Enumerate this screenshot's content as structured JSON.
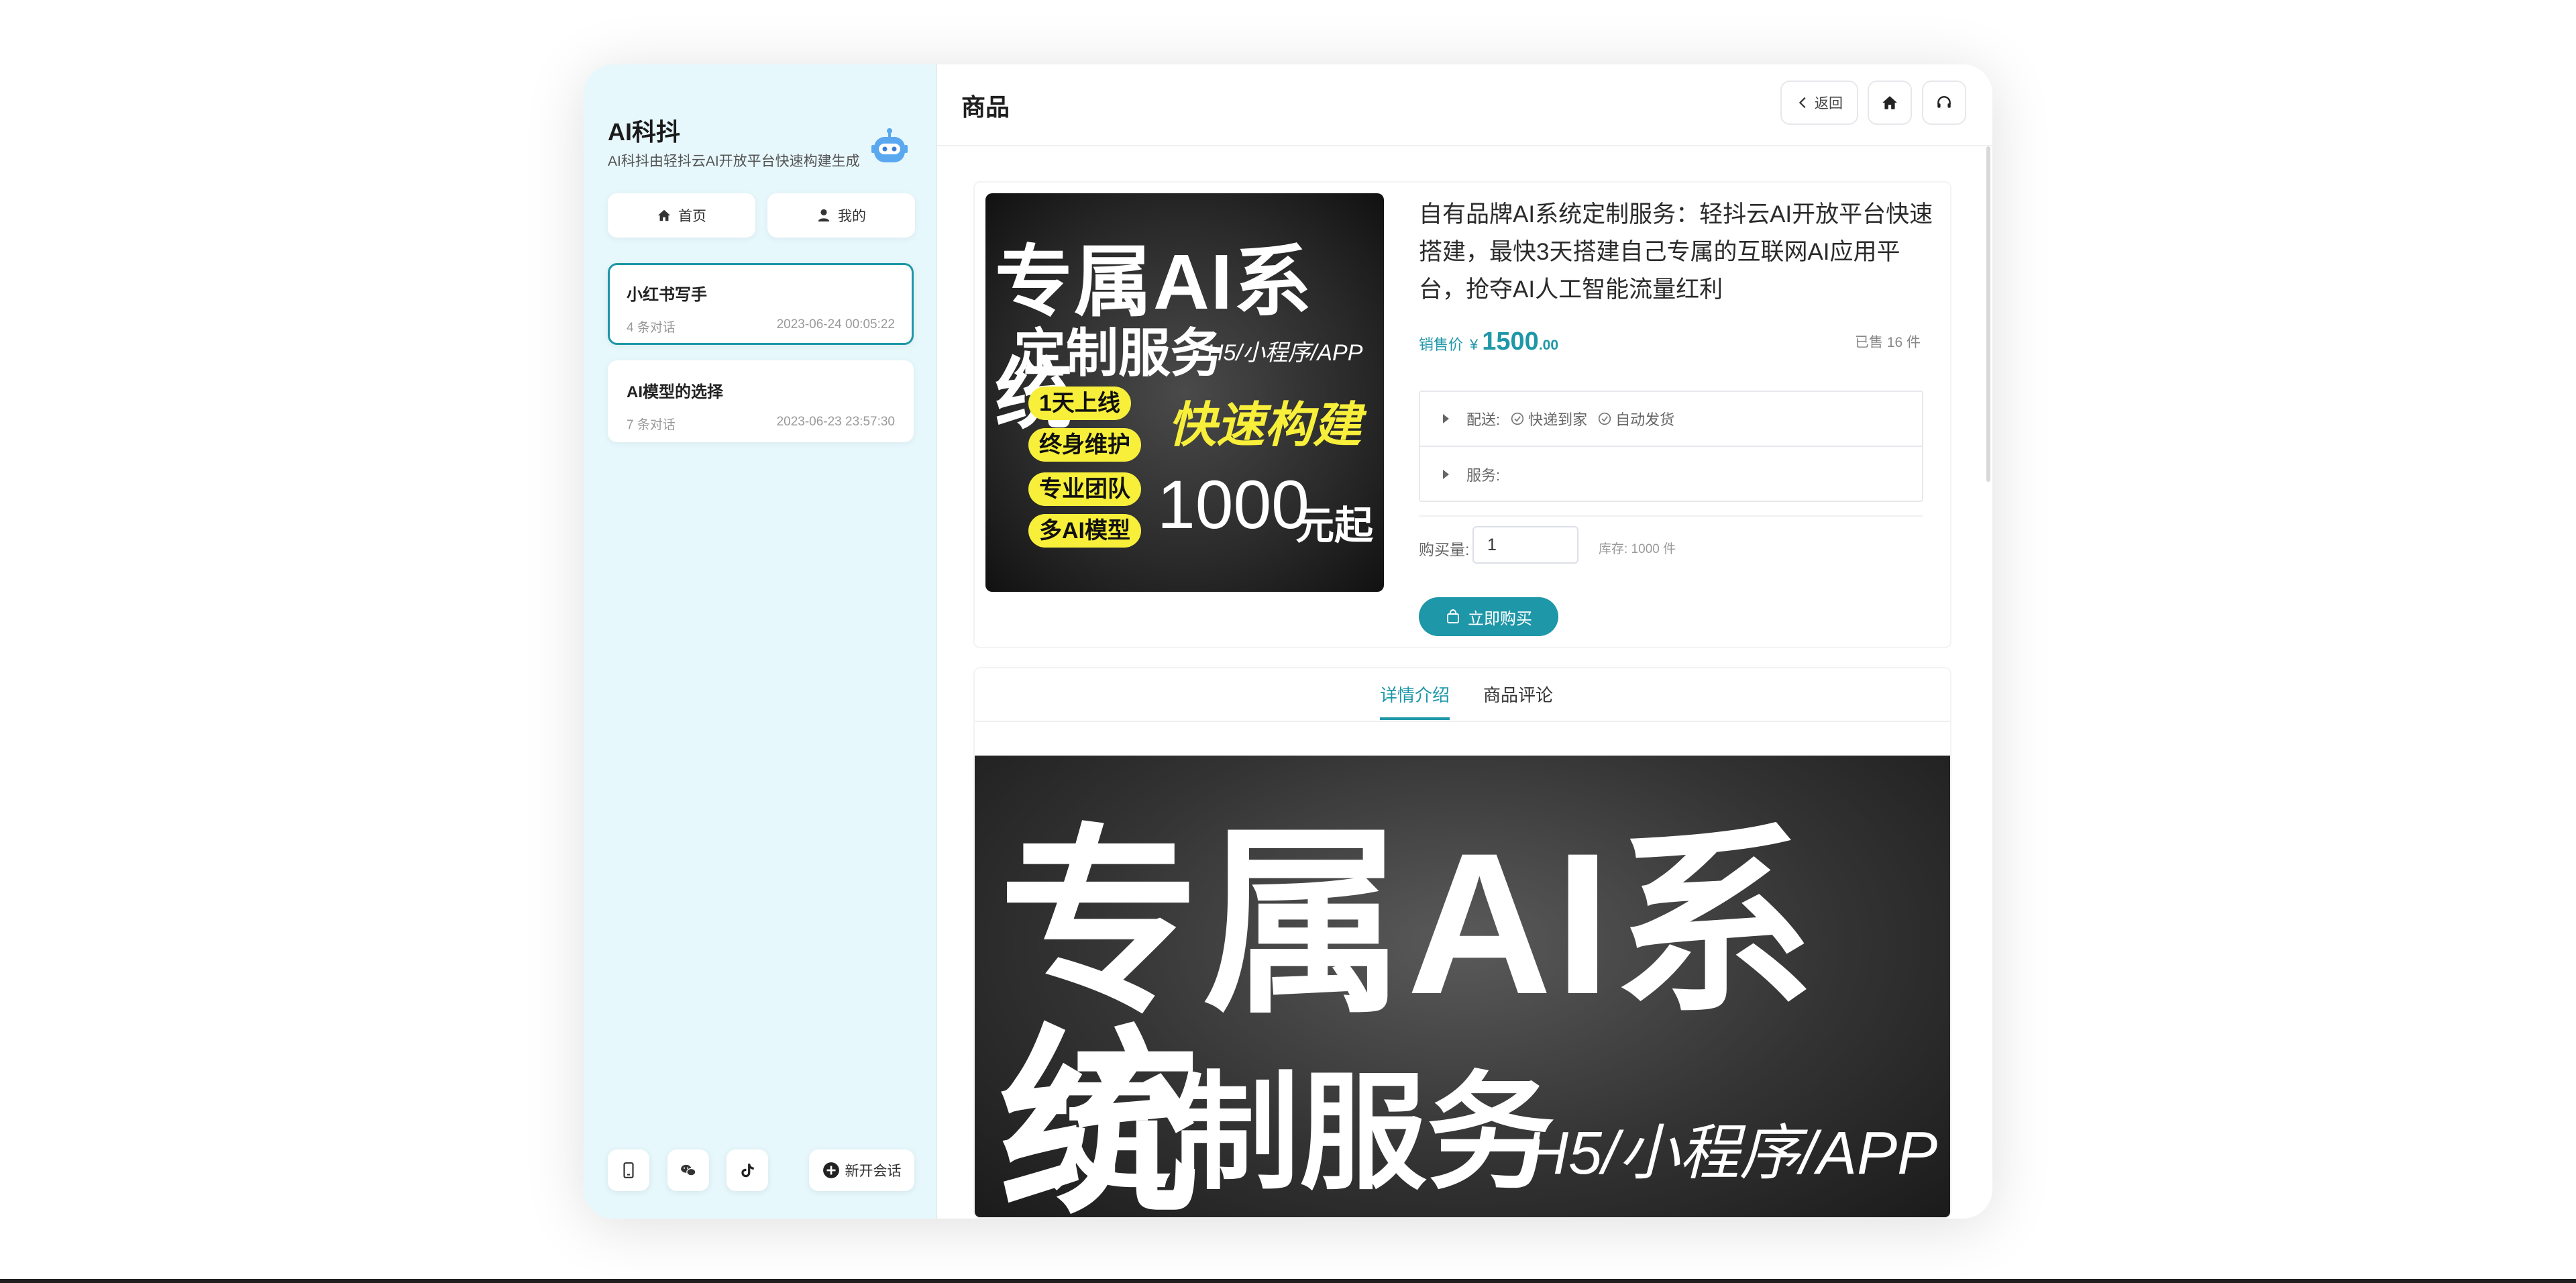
{
  "sidebar": {
    "brand_title": "AI科抖",
    "brand_subtitle": "AI科抖由轻抖云AI开放平台快速构建生成",
    "nav": {
      "home_label": "首页",
      "mine_label": "我的"
    },
    "chats": [
      {
        "title": "小红书写手",
        "count": "4 条对话",
        "time": "2023-06-24 00:05:22",
        "active": true
      },
      {
        "title": "AI模型的选择",
        "count": "7 条对话",
        "time": "2023-06-23 23:57:30",
        "active": false
      }
    ],
    "footer": {
      "new_chat_label": "新开会话"
    }
  },
  "header": {
    "title": "商品",
    "back_label": "返回"
  },
  "product": {
    "poster": {
      "line1": "专属AI系统",
      "line2": "定制服务",
      "line2_suffix": "H5/小程序/APP",
      "pills": [
        "1天上线",
        "终身维护",
        "专业团队",
        "多AI模型"
      ],
      "highlight": "快速构建",
      "price_big": "1000",
      "price_suffix": "元起"
    },
    "title": "自有品牌AI系统定制服务：轻抖云AI开放平台快速搭建，最快3天搭建自己专属的互联网AI应用平台，抢夺AI人工智能流量红利",
    "price_label": "销售价",
    "price_symbol": "¥",
    "price_int": "1500",
    "price_dec": ".00",
    "sold": "已售 16 件",
    "delivery_label": "配送:",
    "delivery_tags": [
      "快递到家",
      "自动发货"
    ],
    "service_label": "服务:",
    "qty_label": "购买量:",
    "qty_value": "1",
    "stock": "库存: 1000 件",
    "buy_label": "立即购买"
  },
  "tabs": {
    "detail": "详情介绍",
    "review": "商品评论",
    "active": "detail"
  },
  "detail_image": {
    "line1": "专属AI系统",
    "line2": "定制服务",
    "line2_suffix": "H5/小程序/APP"
  },
  "colors": {
    "accent": "#1e97a8",
    "sidebar_bg": "#e7f8fd",
    "pill_yellow": "#f7ef3a"
  }
}
